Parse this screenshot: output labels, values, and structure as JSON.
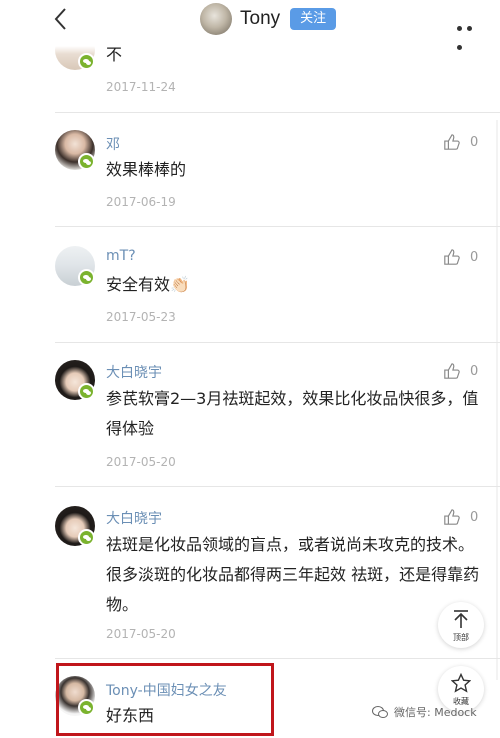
{
  "header": {
    "back_icon": "chevron-left-icon",
    "name": "Tony",
    "follow_label": "关注",
    "more_icon": "more-dots-icon",
    "follow_color": "#5a9be6"
  },
  "comments": [
    {
      "user": "",
      "text": "不",
      "date": "2017-11-24",
      "likes": ""
    },
    {
      "user": "邓",
      "text": "效果棒棒的",
      "date": "2017-06-19",
      "likes": "0"
    },
    {
      "user": "mT?",
      "text": "安全有效👏🏻",
      "date": "2017-05-23",
      "likes": "0"
    },
    {
      "user": "大白晓宇",
      "text": "参芪软膏2—3月祛斑起效，效果比化妆品快很多，值得体验",
      "date": "2017-05-20",
      "likes": "0"
    },
    {
      "user": "大白晓宇",
      "text": "祛斑是化妆品领域的盲点，或者说尚未攻克的技术。很多淡斑的化妆品都得两三年起效 祛斑，还是得靠药物。",
      "date": "2017-05-20",
      "likes": "0"
    },
    {
      "user": "Tony-中国妇女之友",
      "text": "好东西",
      "date": "",
      "likes": ""
    }
  ],
  "float": {
    "top_label": "顶部",
    "fav_label": "收藏"
  },
  "watermark": {
    "text": "微信号: Medock"
  },
  "colors": {
    "username": "#6b8fb5",
    "highlight": "#c0161b",
    "wechat_badge": "#7bb32e"
  }
}
